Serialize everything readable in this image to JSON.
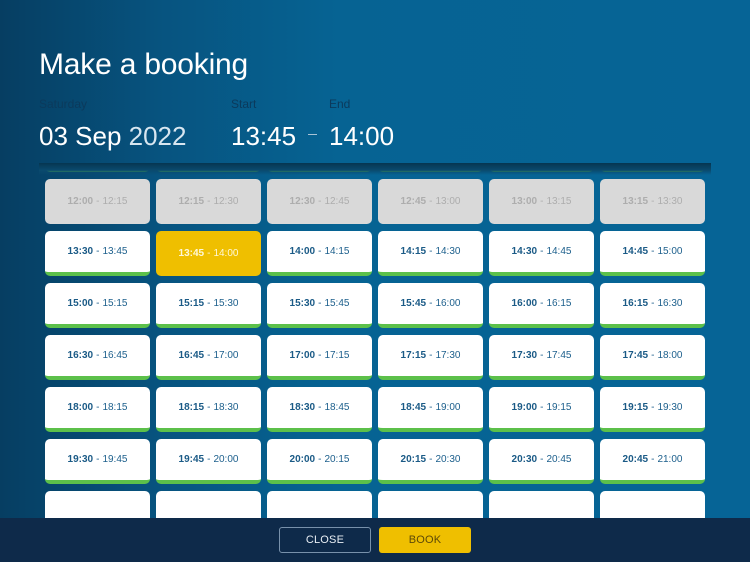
{
  "header": {
    "title": "Make a booking",
    "day_label": "Saturday",
    "date_main": "03 Sep",
    "date_year": "2022",
    "start_label": "Start",
    "end_label": "End",
    "start_time": "13:45",
    "end_time": "14:00"
  },
  "slots": [
    {
      "start": "",
      "end": "",
      "state": "available"
    },
    {
      "start": "",
      "end": "",
      "state": "available"
    },
    {
      "start": "",
      "end": "",
      "state": "available"
    },
    {
      "start": "",
      "end": "",
      "state": "available"
    },
    {
      "start": "",
      "end": "",
      "state": "available"
    },
    {
      "start": "",
      "end": "",
      "state": "available"
    },
    {
      "start": "12:00",
      "end": "12:15",
      "state": "unavailable"
    },
    {
      "start": "12:15",
      "end": "12:30",
      "state": "unavailable"
    },
    {
      "start": "12:30",
      "end": "12:45",
      "state": "unavailable"
    },
    {
      "start": "12:45",
      "end": "13:00",
      "state": "unavailable"
    },
    {
      "start": "13:00",
      "end": "13:15",
      "state": "unavailable"
    },
    {
      "start": "13:15",
      "end": "13:30",
      "state": "unavailable"
    },
    {
      "start": "13:30",
      "end": "13:45",
      "state": "available"
    },
    {
      "start": "13:45",
      "end": "14:00",
      "state": "selected"
    },
    {
      "start": "14:00",
      "end": "14:15",
      "state": "available"
    },
    {
      "start": "14:15",
      "end": "14:30",
      "state": "available"
    },
    {
      "start": "14:30",
      "end": "14:45",
      "state": "available"
    },
    {
      "start": "14:45",
      "end": "15:00",
      "state": "available"
    },
    {
      "start": "15:00",
      "end": "15:15",
      "state": "available"
    },
    {
      "start": "15:15",
      "end": "15:30",
      "state": "available"
    },
    {
      "start": "15:30",
      "end": "15:45",
      "state": "available"
    },
    {
      "start": "15:45",
      "end": "16:00",
      "state": "available"
    },
    {
      "start": "16:00",
      "end": "16:15",
      "state": "available"
    },
    {
      "start": "16:15",
      "end": "16:30",
      "state": "available"
    },
    {
      "start": "16:30",
      "end": "16:45",
      "state": "available"
    },
    {
      "start": "16:45",
      "end": "17:00",
      "state": "available"
    },
    {
      "start": "17:00",
      "end": "17:15",
      "state": "available"
    },
    {
      "start": "17:15",
      "end": "17:30",
      "state": "available"
    },
    {
      "start": "17:30",
      "end": "17:45",
      "state": "available"
    },
    {
      "start": "17:45",
      "end": "18:00",
      "state": "available"
    },
    {
      "start": "18:00",
      "end": "18:15",
      "state": "available"
    },
    {
      "start": "18:15",
      "end": "18:30",
      "state": "available"
    },
    {
      "start": "18:30",
      "end": "18:45",
      "state": "available"
    },
    {
      "start": "18:45",
      "end": "19:00",
      "state": "available"
    },
    {
      "start": "19:00",
      "end": "19:15",
      "state": "available"
    },
    {
      "start": "19:15",
      "end": "19:30",
      "state": "available"
    },
    {
      "start": "19:30",
      "end": "19:45",
      "state": "available"
    },
    {
      "start": "19:45",
      "end": "20:00",
      "state": "available"
    },
    {
      "start": "20:00",
      "end": "20:15",
      "state": "available"
    },
    {
      "start": "20:15",
      "end": "20:30",
      "state": "available"
    },
    {
      "start": "20:30",
      "end": "20:45",
      "state": "available"
    },
    {
      "start": "20:45",
      "end": "21:00",
      "state": "available"
    },
    {
      "start": "",
      "end": "",
      "state": "available"
    },
    {
      "start": "",
      "end": "",
      "state": "available"
    },
    {
      "start": "",
      "end": "",
      "state": "available"
    },
    {
      "start": "",
      "end": "",
      "state": "available"
    },
    {
      "start": "",
      "end": "",
      "state": "available"
    },
    {
      "start": "",
      "end": "",
      "state": "available"
    }
  ],
  "slot_separator": "-",
  "footer": {
    "close_label": "CLOSE",
    "book_label": "BOOK"
  },
  "colors": {
    "selected": "#efbf00",
    "available_indicator": "#5cc04a",
    "unavailable": "#d9d9d9",
    "background": "#066496",
    "footer": "#0e2a4a"
  }
}
